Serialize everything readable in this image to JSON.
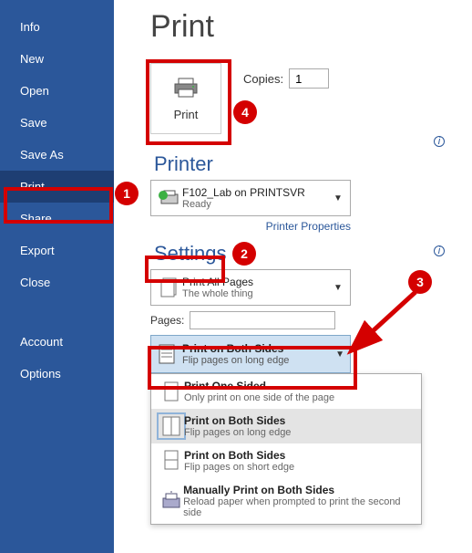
{
  "sidebar": {
    "items": [
      {
        "label": "Info"
      },
      {
        "label": "New"
      },
      {
        "label": "Open"
      },
      {
        "label": "Save"
      },
      {
        "label": "Save As"
      },
      {
        "label": "Print"
      },
      {
        "label": "Share"
      },
      {
        "label": "Export"
      },
      {
        "label": "Close"
      },
      {
        "label": "Account"
      },
      {
        "label": "Options"
      }
    ]
  },
  "title": "Print",
  "print_button": {
    "label": "Print"
  },
  "copies": {
    "label": "Copies:",
    "value": "1"
  },
  "printer": {
    "heading": "Printer",
    "name": "F102_Lab on PRINTSVR",
    "status": "Ready",
    "properties_link": "Printer Properties"
  },
  "settings": {
    "heading": "Settings",
    "pages_setting": {
      "line1": "Print All Pages",
      "line2": "The whole thing"
    },
    "pages_label": "Pages:",
    "pages_value": "",
    "sides_selected": {
      "line1": "Print on Both Sides",
      "line2": "Flip pages on long edge"
    },
    "sides_options": [
      {
        "line1": "Print One Sided",
        "line2": "Only print on one side of the page"
      },
      {
        "line1": "Print on Both Sides",
        "line2": "Flip pages on long edge"
      },
      {
        "line1": "Print on Both Sides",
        "line2": "Flip pages on short edge"
      },
      {
        "line1": "Manually Print on Both Sides",
        "line2": "Reload paper when prompted to print the second side"
      }
    ]
  },
  "annotations": {
    "a1": "1",
    "a2": "2",
    "a3": "3",
    "a4": "4"
  }
}
